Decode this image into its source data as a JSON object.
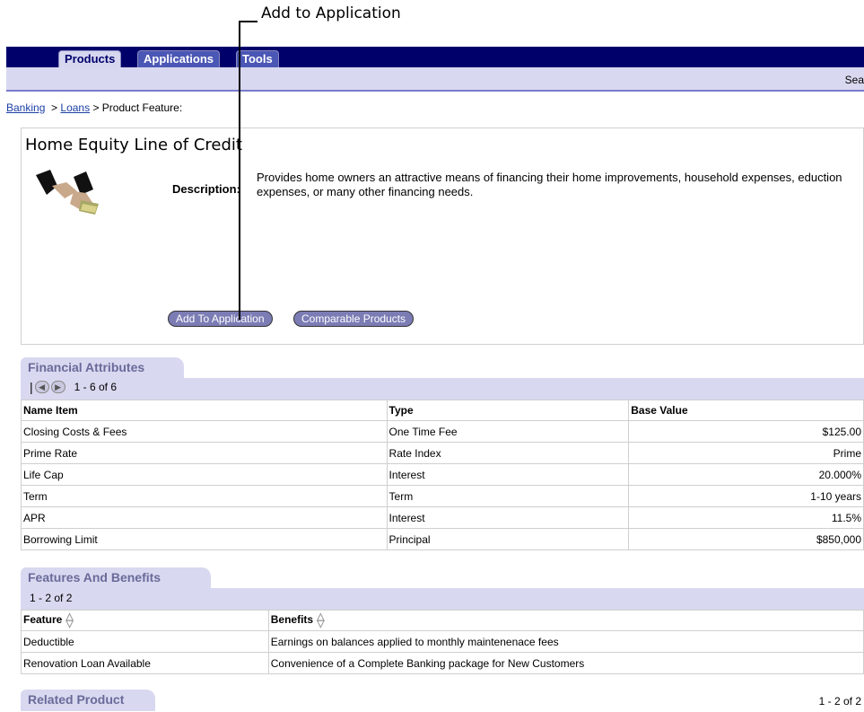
{
  "callout": {
    "label": "Add to Application"
  },
  "nav": {
    "tabs": [
      "Products",
      "Applications",
      "Tools"
    ],
    "search_stub": "Sea"
  },
  "breadcrumb": {
    "link1": "Banking",
    "link2": "Loans",
    "current": "> Product Feature:"
  },
  "product": {
    "title": "Home Equity Line of Credit",
    "description_label": "Description:",
    "description": "Provides home owners an attractive means of financing their home improvements, household expenses, eduction expenses, or many other financing needs.",
    "buttons": {
      "add": "Add To Application",
      "compare": "Comparable Products"
    }
  },
  "financial": {
    "title": "Financial Attributes",
    "range": "1 - 6 of 6",
    "headers": [
      "Name Item",
      "Type",
      "Base Value"
    ],
    "rows": [
      [
        "Closing Costs & Fees",
        "One Time Fee",
        "$125.00"
      ],
      [
        "Prime Rate",
        "Rate Index",
        "Prime"
      ],
      [
        "Life Cap",
        "Interest",
        "20.000%"
      ],
      [
        "Term",
        "Term",
        "1-10 years"
      ],
      [
        "APR",
        "Interest",
        "11.5%"
      ],
      [
        "Borrowing Limit",
        "Principal",
        "$850,000"
      ]
    ]
  },
  "features": {
    "title": "Features And Benefits",
    "range": "1 - 2 of 2",
    "headers": [
      "Feature",
      "Benefits"
    ],
    "rows": [
      [
        "Deductible",
        "Earnings on balances applied to monthly maintenenace fees"
      ],
      [
        "Renovation Loan Available",
        "Convenience of a Complete Banking package for New Customers"
      ]
    ]
  },
  "related": {
    "title": "Related Product",
    "range": "1 - 2 of 2"
  }
}
